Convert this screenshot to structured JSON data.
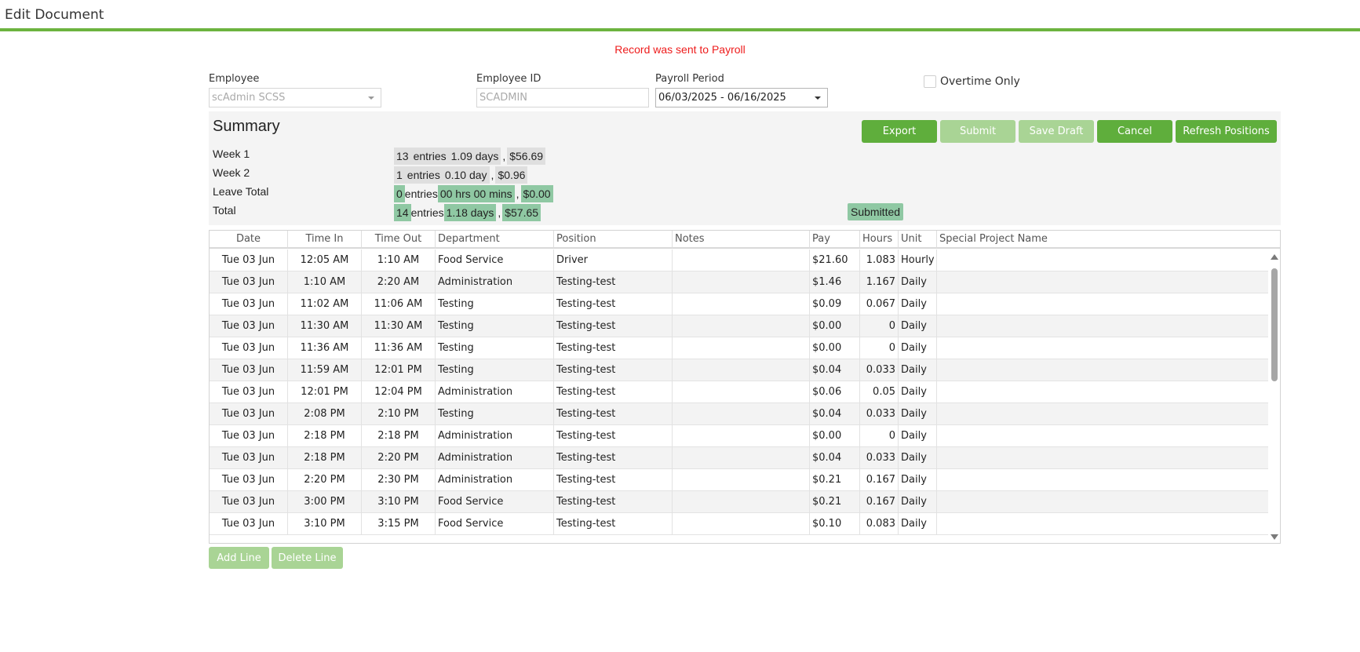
{
  "page": {
    "title": "Edit Document",
    "notice": "Record was sent to Payroll",
    "accent_color": "#6cb33f",
    "notice_color": "#ee1c1c"
  },
  "form": {
    "employee": {
      "label": "Employee",
      "value": "scAdmin SCSS"
    },
    "employee_id": {
      "label": "Employee ID",
      "value": "SCADMIN"
    },
    "payroll_period": {
      "label": "Payroll Period",
      "value": "06/03/2025 - 06/16/2025"
    },
    "overtime_only": {
      "label": "Overtime Only",
      "checked": false
    }
  },
  "summary": {
    "title": "Summary",
    "buttons": {
      "export": "Export",
      "submit": "Submit",
      "save_draft": "Save Draft",
      "cancel": "Cancel",
      "refresh": "Refresh Positions"
    },
    "rows": [
      {
        "label": "Week 1",
        "count": "13",
        "entries_word": "entries",
        "duration": "1.09 days",
        "sep": ",",
        "amount": "$56.69"
      },
      {
        "label": "Week 2",
        "count": "1",
        "entries_word": "entries",
        "duration": "0.10 day",
        "sep": ",",
        "amount": "$0.96"
      },
      {
        "label": "Leave Total",
        "count": "0",
        "entries_word": "entries",
        "duration": "00 hrs 00 mins",
        "sep": ",",
        "amount": "$0.00"
      },
      {
        "label": "Total",
        "count": "14",
        "entries_word": "entries",
        "duration": "1.18 days",
        "sep": ",",
        "amount": "$57.65"
      }
    ],
    "status": "Submitted"
  },
  "grid": {
    "columns": [
      "Date",
      "Time In",
      "Time Out",
      "Department",
      "Position",
      "Notes",
      "Pay",
      "Hours",
      "Unit",
      "Special Project Name"
    ],
    "rows": [
      [
        "Tue 03 Jun",
        "12:05 AM",
        "1:10 AM",
        "Food Service",
        "Driver",
        "",
        "$21.60",
        "1.083",
        "Hourly",
        ""
      ],
      [
        "Tue 03 Jun",
        "1:10 AM",
        "2:20 AM",
        "Administration",
        "Testing-test",
        "",
        "$1.46",
        "1.167",
        "Daily",
        ""
      ],
      [
        "Tue 03 Jun",
        "11:02 AM",
        "11:06 AM",
        "Testing",
        "Testing-test",
        "",
        "$0.09",
        "0.067",
        "Daily",
        ""
      ],
      [
        "Tue 03 Jun",
        "11:30 AM",
        "11:30 AM",
        "Testing",
        "Testing-test",
        "",
        "$0.00",
        "0",
        "Daily",
        ""
      ],
      [
        "Tue 03 Jun",
        "11:36 AM",
        "11:36 AM",
        "Testing",
        "Testing-test",
        "",
        "$0.00",
        "0",
        "Daily",
        ""
      ],
      [
        "Tue 03 Jun",
        "11:59 AM",
        "12:01 PM",
        "Testing",
        "Testing-test",
        "",
        "$0.04",
        "0.033",
        "Daily",
        ""
      ],
      [
        "Tue 03 Jun",
        "12:01 PM",
        "12:04 PM",
        "Administration",
        "Testing-test",
        "",
        "$0.06",
        "0.05",
        "Daily",
        ""
      ],
      [
        "Tue 03 Jun",
        "2:08 PM",
        "2:10 PM",
        "Testing",
        "Testing-test",
        "",
        "$0.04",
        "0.033",
        "Daily",
        ""
      ],
      [
        "Tue 03 Jun",
        "2:18 PM",
        "2:18 PM",
        "Administration",
        "Testing-test",
        "",
        "$0.00",
        "0",
        "Daily",
        ""
      ],
      [
        "Tue 03 Jun",
        "2:18 PM",
        "2:20 PM",
        "Administration",
        "Testing-test",
        "",
        "$0.04",
        "0.033",
        "Daily",
        ""
      ],
      [
        "Tue 03 Jun",
        "2:20 PM",
        "2:30 PM",
        "Administration",
        "Testing-test",
        "",
        "$0.21",
        "0.167",
        "Daily",
        ""
      ],
      [
        "Tue 03 Jun",
        "3:00 PM",
        "3:10 PM",
        "Food Service",
        "Testing-test",
        "",
        "$0.21",
        "0.167",
        "Daily",
        ""
      ],
      [
        "Tue 03 Jun",
        "3:10 PM",
        "3:15 PM",
        "Food Service",
        "Testing-test",
        "",
        "$0.10",
        "0.083",
        "Daily",
        ""
      ]
    ]
  },
  "footer": {
    "add_line": "Add Line",
    "delete_line": "Delete Line"
  }
}
